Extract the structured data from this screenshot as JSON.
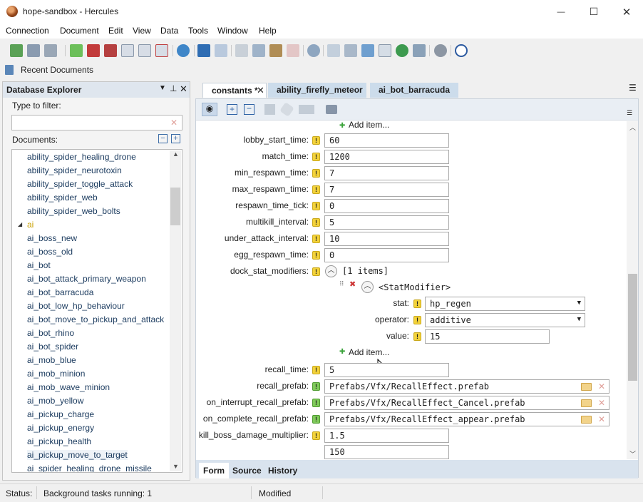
{
  "window": {
    "title": "hope-sandbox - Hercules",
    "minimize_glyph": "—",
    "maximize_glyph": "☐",
    "close_glyph": "✕"
  },
  "menu": [
    "Connection",
    "Document",
    "Edit",
    "View",
    "Data",
    "Tools",
    "Window",
    "Help"
  ],
  "recent": {
    "label": "Recent Documents"
  },
  "explorer": {
    "title": "Database Explorer",
    "filter_label": "Type to filter:",
    "filter_value": "",
    "documents_label": "Documents:",
    "items": [
      "ability_spider_healing_drone",
      "ability_spider_neurotoxin",
      "ability_spider_toggle_attack",
      "ability_spider_web",
      "ability_spider_web_bolts",
      "ai",
      "ai_boss_new",
      "ai_boss_old",
      "ai_bot",
      "ai_bot_attack_primary_weapon",
      "ai_bot_barracuda",
      "ai_bot_low_hp_behaviour",
      "ai_bot_move_to_pickup_and_attack",
      "ai_bot_rhino",
      "ai_bot_spider",
      "ai_mob_blue",
      "ai_mob_minion",
      "ai_mob_wave_minion",
      "ai_mob_yellow",
      "ai_pickup_charge",
      "ai_pickup_energy",
      "ai_pickup_health",
      "ai_pickup_move_to_target",
      "ai_spider_healing_drone_missile"
    ]
  },
  "tabs": [
    {
      "label": "constants *",
      "active": true
    },
    {
      "label": "ability_firefly_meteor",
      "active": false
    },
    {
      "label": "ai_bot_barracuda",
      "active": false
    }
  ],
  "form": {
    "add_item_top": "Add item...",
    "fields": [
      {
        "label": "lobby_start_time:",
        "value": "60"
      },
      {
        "label": "match_time:",
        "value": "1200"
      },
      {
        "label": "min_respawn_time:",
        "value": "7"
      },
      {
        "label": "max_respawn_time:",
        "value": "7"
      },
      {
        "label": "respawn_time_tick:",
        "value": "0"
      },
      {
        "label": "multikill_interval:",
        "value": "5"
      },
      {
        "label": "under_attack_interval:",
        "value": "10"
      },
      {
        "label": "egg_respawn_time:",
        "value": "0"
      }
    ],
    "dock_label": "dock_stat_modifiers:",
    "dock_count": "[1 items]",
    "stat_modifier": {
      "type": "<StatModifier>",
      "stat_label": "stat:",
      "stat_value": "hp_regen",
      "operator_label": "operator:",
      "operator_value": "additive",
      "value_label": "value:",
      "value_value": "15"
    },
    "add_item": "Add item...",
    "recall_time_label": "recall_time:",
    "recall_time_value": "5",
    "prefabs": [
      {
        "label": "recall_prefab:",
        "value": "Prefabs/Vfx/RecallEffect.prefab"
      },
      {
        "label": "on_interrupt_recall_prefab:",
        "value": "Prefabs/Vfx/RecallEffect_Cancel.prefab"
      },
      {
        "label": "on_complete_recall_prefab:",
        "value": "Prefabs/Vfx/RecallEffect_appear.prefab"
      }
    ],
    "kill_boss_label": "kill_boss_damage_multiplier:",
    "kill_boss_value": "1.5",
    "cut_value": "150"
  },
  "bottom_tabs": [
    "Form",
    "Source",
    "History"
  ],
  "status": {
    "label": "Status:",
    "tasks": "Background tasks running: 1",
    "modified": "Modified"
  }
}
